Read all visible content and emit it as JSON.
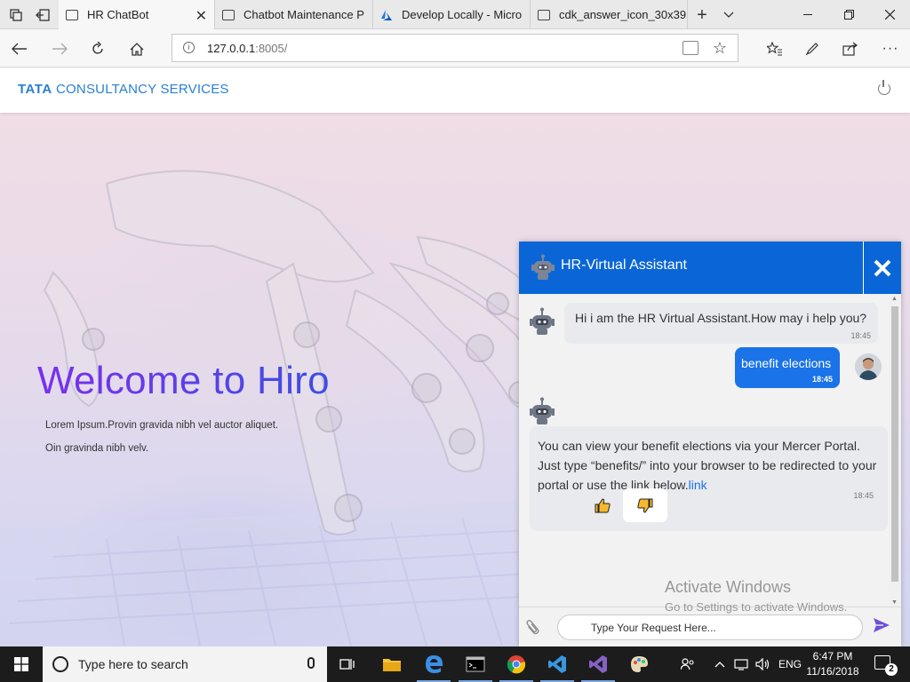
{
  "browser": {
    "tabs": [
      {
        "label": "HR ChatBot",
        "active": true
      },
      {
        "label": "Chatbot Maintenance P",
        "active": false
      },
      {
        "label": "Develop Locally - Micro",
        "active": false
      },
      {
        "label": "cdk_answer_icon_30x39",
        "active": false
      }
    ],
    "url_host": "127.0.0.1",
    "url_port": ":8005/"
  },
  "site": {
    "brand_strong": "TATA",
    "brand_rest": " CONSULTANCY SERVICES",
    "hero_title": "Welcome to Hiro",
    "hero_line1": "Lorem Ipsum.Provin gravida nibh vel auctor aliquet.",
    "hero_line2": "Oin gravinda nibh velv."
  },
  "chat": {
    "title": "HR-Virtual Assistant",
    "messages": [
      {
        "from": "bot",
        "text": "Hi i am the HR Virtual Assistant.How may i help you?",
        "time": "18:45"
      },
      {
        "from": "user",
        "text": "benefit elections",
        "time": "18:45"
      },
      {
        "from": "bot",
        "text": "You can view your benefit elections via your Mercer Portal. Just type “benefits/” into your browser to be redirected to your portal or use the link below.",
        "link": "link",
        "time": "18:45"
      }
    ],
    "input_placeholder": "Type Your Request Here...",
    "brand_color": "#0a66d6"
  },
  "watermark": {
    "line1": "Activate Windows",
    "line2": "Go to Settings to activate Windows."
  },
  "taskbar": {
    "search_placeholder": "Type here to search",
    "language": "ENG",
    "time": "6:47 PM",
    "date": "11/16/2018",
    "notification_count": "2"
  }
}
